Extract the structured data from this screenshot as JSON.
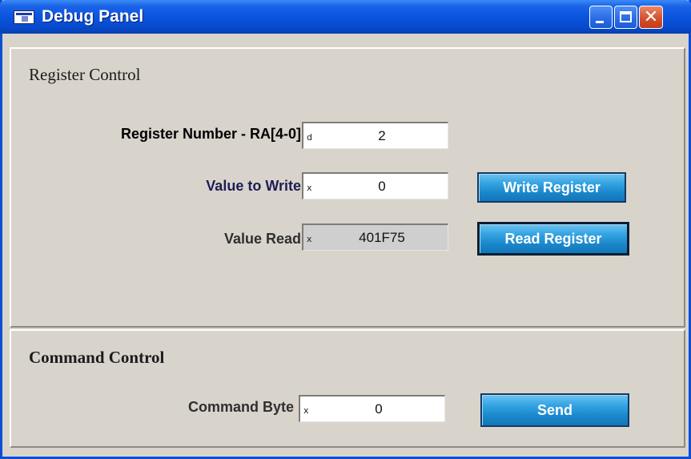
{
  "window": {
    "title": "Debug Panel",
    "controls": {
      "minimize": "minimize-icon",
      "maximize": "maximize-icon",
      "close": "✕"
    }
  },
  "register_control": {
    "title": "Register Control",
    "register_number": {
      "label": "Register Number - RA[4-0]",
      "radix": "d",
      "value": "2"
    },
    "value_to_write": {
      "label": "Value to Write",
      "radix": "x",
      "value": "0"
    },
    "value_read": {
      "label": "Value Read",
      "radix": "x",
      "value": "401F75"
    },
    "write_button": "Write Register",
    "read_button": "Read Register"
  },
  "command_control": {
    "title": "Command Control",
    "command_byte": {
      "label": "Command Byte",
      "radix": "x",
      "value": "0"
    },
    "send_button": "Send"
  },
  "colors": {
    "titlebar": "#0a55df",
    "window_bg": "#d8d4cc",
    "button": "#1a86cb",
    "close_button": "#d5502b"
  }
}
